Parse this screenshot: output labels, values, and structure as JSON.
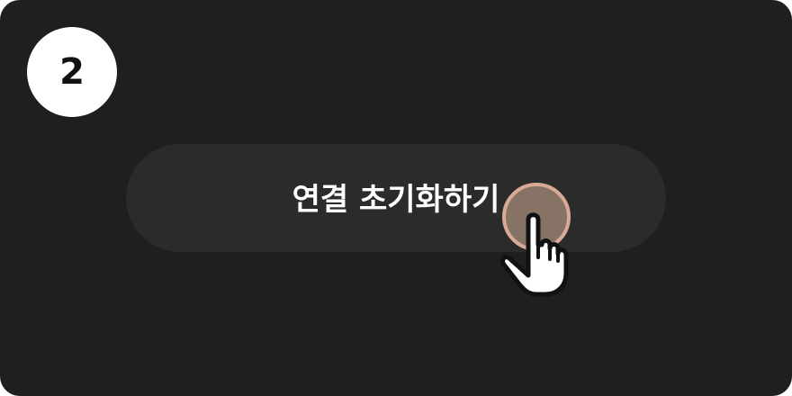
{
  "step": {
    "number": "2"
  },
  "button": {
    "label": "연결 초기화하기"
  },
  "icons": {
    "cursor": "hand-pointer-icon",
    "tap": "tap-indicator-circle"
  },
  "colors": {
    "card_background": "#1f1f1f",
    "button_background": "#2b2b2b",
    "badge_background": "#ffffff",
    "tap_indicator": "#d9ab96"
  }
}
